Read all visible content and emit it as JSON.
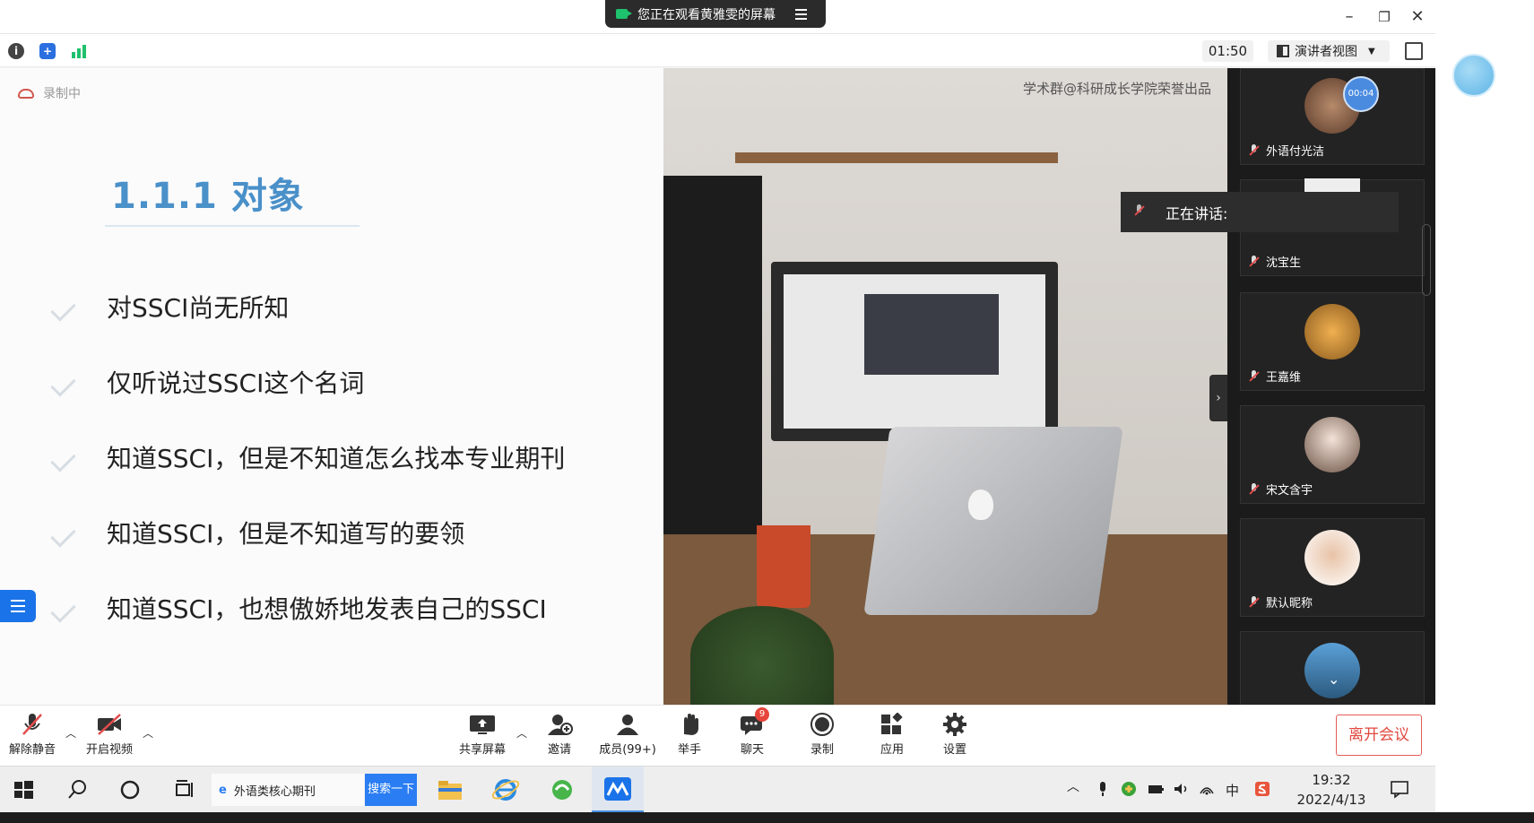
{
  "window": {
    "share_banner": "您正在观看黄雅雯的屏幕",
    "timer": "01:50",
    "view_mode": "演讲者视图"
  },
  "slide": {
    "recording_label": "录制中",
    "title": "1.1.1 对象",
    "bullets": [
      "对SSCI尚无所知",
      "仅听说过SSCI这个名词",
      "知道SSCI，但是不知道怎么找本专业期刊",
      "知道SSCI，但是不知道写的要领",
      "知道SSCI，也想傲娇地发表自己的SSCI"
    ]
  },
  "shared_video": {
    "watermark": "学术群@科研成长学院荣誉出品"
  },
  "speaking": {
    "label": "正在讲话:"
  },
  "participants": [
    {
      "name": "外语付光洁",
      "muted": true,
      "badge": "00:04"
    },
    {
      "name": "沈宝生",
      "muted": true
    },
    {
      "name": "王嘉维",
      "muted": true
    },
    {
      "name": "宋文含宇",
      "muted": true
    },
    {
      "name": "默认昵称",
      "muted": true
    },
    {
      "name": "",
      "muted": true
    }
  ],
  "controls": {
    "unmute": "解除静音",
    "start_video": "开启视频",
    "share_screen": "共享屏幕",
    "invite": "邀请",
    "members": "成员(99+)",
    "raise_hand": "举手",
    "chat": "聊天",
    "chat_badge": "9",
    "record": "录制",
    "apps": "应用",
    "settings": "设置",
    "leave": "离开会议"
  },
  "taskbar": {
    "search_text": "外语类核心期刊",
    "search_button": "搜索一下",
    "time": "19:32",
    "date": "2022/4/13",
    "ime": "中"
  },
  "colors": {
    "accent_blue": "#1a73e8",
    "slide_title": "#4a90c9",
    "leave_red": "#e0483f",
    "signal_green": "#1ec16c"
  }
}
